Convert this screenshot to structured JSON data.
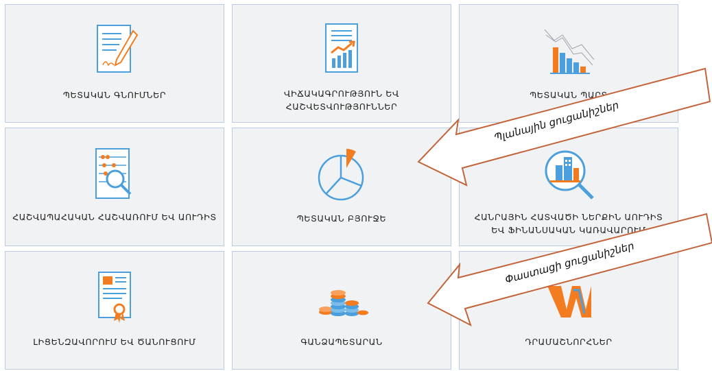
{
  "tiles": [
    {
      "id": "state-loans",
      "label": "ՊԵՏԱԿԱՆ ԳՆՈՒՄՆԵՐ",
      "icon": "contract-signature-icon"
    },
    {
      "id": "statistics",
      "label": "ՎԻՃԱԿԱԳՐՈՒԹՅՈՒՆ ԵՎ ՀԱՇՎԵՏՎՈՒԹՅՈՒՆՆԵՐ",
      "icon": "report-growth-chart-icon"
    },
    {
      "id": "state-debt",
      "label": "ՊԵՏԱԿԱՆ ՊԱՐՏ",
      "icon": "bar-chart-trend-icon"
    },
    {
      "id": "accounting",
      "label": "ՀԱՇՎԱՊԱՀԱԿԱՆ ՀԱՇՎԱՌՈՒՄ ԵՎ ԱՈՒԴԻՏ",
      "icon": "abacus-magnifier-icon"
    },
    {
      "id": "state-budget",
      "label": "ՊԵՏԱԿԱՆ ԲՅՈՒՋԵ",
      "icon": "pie-chart-icon"
    },
    {
      "id": "public-sector",
      "label": "ՀԱՆՐԱՅԻՆ ՀԱՏՎԱԾԻ ՆԵՐՔԻՆ ԱՈՒԴԻՏ ԵՎ ՖԻՆԱՆՍԱԿԱՆ ԿԱՌԱՎԱՐՈՒՄ",
      "icon": "building-magnifier-icon"
    },
    {
      "id": "licensing",
      "label": "ԼԻՑԵՆԶԱՎՈՐՈՒՄ ԵՎ ԾԱՆՈՒՑՈՒՄ",
      "icon": "certificate-icon"
    },
    {
      "id": "treasury",
      "label": "ԳԱՆՁԱՊԵՏԱՐԱՆ",
      "icon": "coin-stacks-icon"
    },
    {
      "id": "money-market",
      "label": "ԴՐԱՄԱՇՆՈՐՀՆԵՐ",
      "icon": "w-logo-icon"
    }
  ],
  "callouts": {
    "planned": "Պլանային ցուցանիշներ",
    "actual": "Փաստացի ցուցանիշներ"
  },
  "colors": {
    "tile_bg": "#f1f2f4",
    "tile_border": "#b9cbe0",
    "icon_blue": "#4a9fdc",
    "icon_orange": "#f47c20",
    "callout_stroke": "#c2633a",
    "callout_fill": "#ffffff"
  }
}
